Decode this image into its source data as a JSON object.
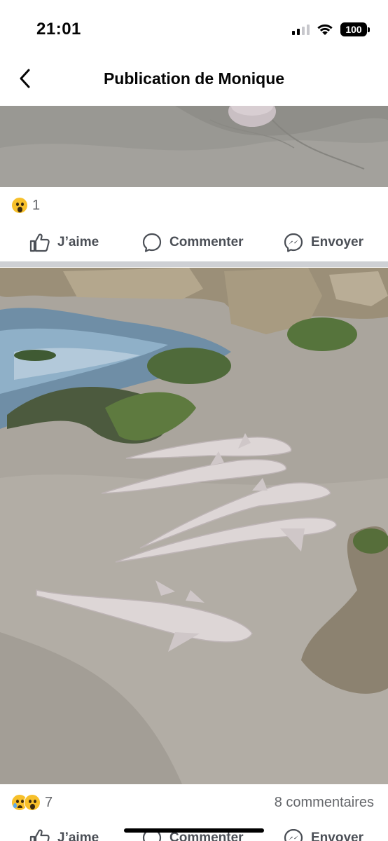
{
  "status_bar": {
    "time": "21:01",
    "battery": "100",
    "icons": [
      "cellular-signal-icon",
      "wifi-icon",
      "battery-icon"
    ]
  },
  "header": {
    "title": "Publication de Monique",
    "back_icon": "chevron-left-icon"
  },
  "posts": [
    {
      "image_description_icon": "beach-sand-photo",
      "reaction_count": "1",
      "reactions": [
        "wow"
      ],
      "actions": {
        "like": "J’aime",
        "comment": "Commenter",
        "send": "Envoyer"
      }
    },
    {
      "image_description_icon": "sharks-on-beach-photo",
      "reaction_count": "7",
      "reactions": [
        "sad",
        "wow"
      ],
      "comments": "8 commentaires",
      "actions": {
        "like": "J’aime",
        "comment": "Commenter",
        "send": "Envoyer"
      }
    }
  ],
  "colors": {
    "text_primary": "#050505",
    "text_secondary": "#65676b",
    "separator": "#ced0d4",
    "reaction_yellow": "#f7c02b"
  }
}
